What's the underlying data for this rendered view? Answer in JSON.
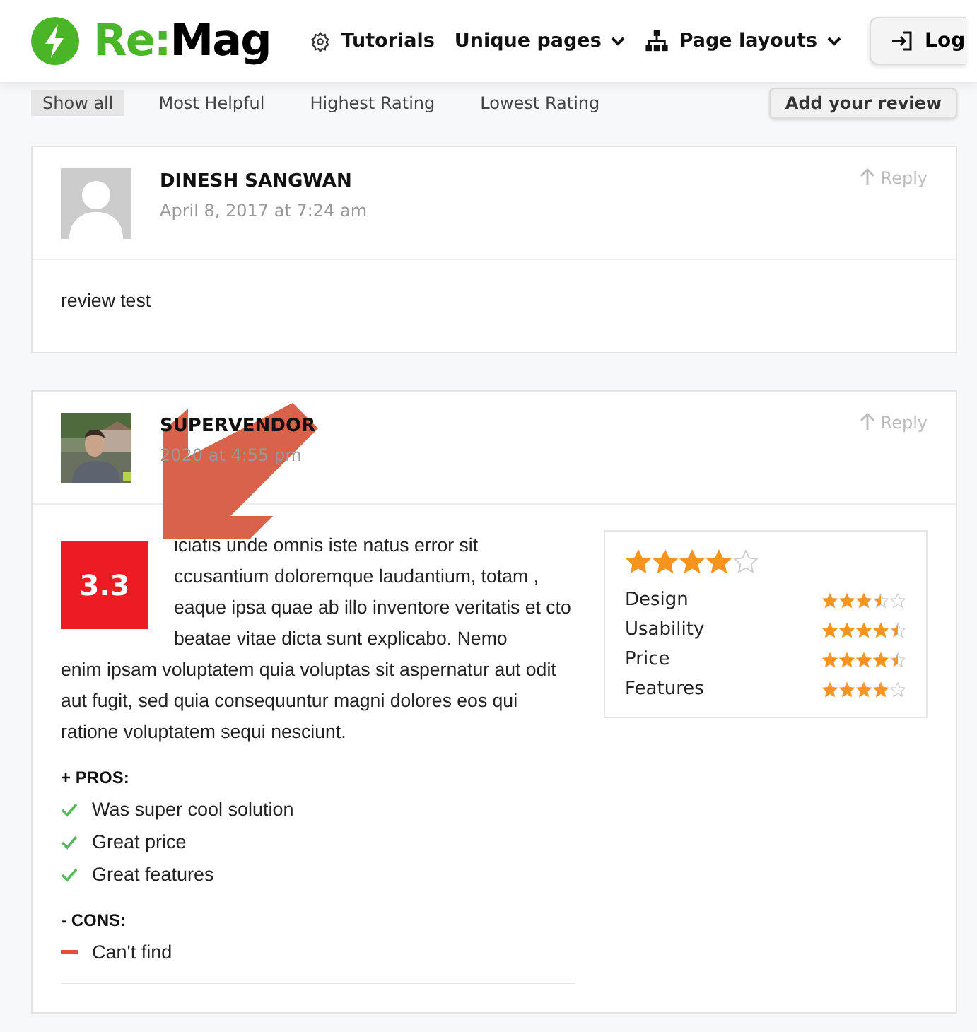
{
  "header": {
    "logo": "Re:Mag",
    "nav": [
      {
        "label": "Tutorials",
        "kind": "gear"
      },
      {
        "label": "Unique pages",
        "kind": "dropdown"
      },
      {
        "label": "Page layouts",
        "kind": "sitemap"
      }
    ],
    "login": "Log"
  },
  "filters": {
    "tabs": [
      {
        "label": "Show all",
        "selected": true
      },
      {
        "label": "Most Helpful",
        "selected": false
      },
      {
        "label": "Highest Rating",
        "selected": false
      },
      {
        "label": "Lowest Rating",
        "selected": false
      }
    ],
    "add_button": "Add your review"
  },
  "reviews": [
    {
      "author": "DINESH SANGWAN",
      "date": "April 8, 2017 at 7:24 am",
      "reply": "Reply",
      "avatar": {
        "kind": "silhouette"
      },
      "text": "review test"
    },
    {
      "author": "SUPERVENDOR",
      "date": "2020 at 4:55 pm",
      "reply": "Reply",
      "avatar": {
        "kind": "picture"
      },
      "score": "3.3",
      "text_beside": "iciatis unde omnis iste natus error sit ccusantium doloremque laudantium, totam , eaque ipsa quae ab illo inventore veritatis et cto beatae vitae dicta sunt explicabo. Nemo",
      "text": "enim ipsam voluptatem quia voluptas sit aspernatur aut odit aut fugit, sed quia consequuntur magni dolores eos qui ratione voluptatem sequi nesciunt.",
      "pros_title": "+ PROS:",
      "pros": [
        "Was super cool solution",
        "Great price",
        "Great features"
      ],
      "cons_title": "- CONS:",
      "cons": [
        "Can't find"
      ],
      "rating": {
        "stars": 4,
        "criteria": [
          {
            "name": "Design",
            "stars": 3.5
          },
          {
            "name": "Usability",
            "stars": 4.5
          },
          {
            "name": "Price",
            "stars": 4.5
          },
          {
            "name": "Features",
            "stars": 4
          }
        ]
      }
    }
  ]
}
